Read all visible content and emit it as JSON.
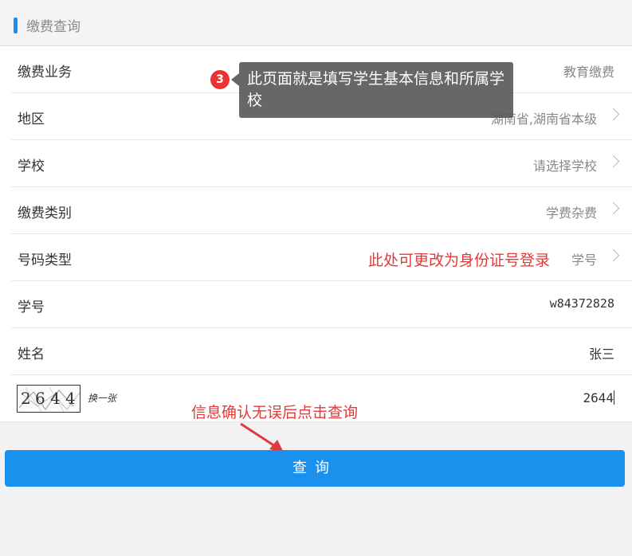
{
  "section": {
    "title": "缴费查询"
  },
  "rows": {
    "business": {
      "label": "缴费业务",
      "value": "教育缴费"
    },
    "region": {
      "label": "地区",
      "value": "湖南省,湖南省本级"
    },
    "school": {
      "label": "学校",
      "value": "请选择学校"
    },
    "fee_type": {
      "label": "缴费类别",
      "value": "学费杂费"
    },
    "id_type": {
      "label": "号码类型",
      "value": "学号"
    },
    "student_no": {
      "label": "学号",
      "value": "w84372828"
    },
    "name": {
      "label": "姓名",
      "value": "张三"
    },
    "captcha": {
      "digits": [
        "2",
        "6",
        "4",
        "4"
      ],
      "refresh_label": "换一张",
      "value": "2644"
    }
  },
  "tooltip": {
    "step": "3",
    "text": "此页面就是填写学生基本信息和所属学校"
  },
  "annotations": {
    "id_type_hint": "此处可更改为身份证号登录",
    "confirm_hint": "信息确认无误后点击查询"
  },
  "query_button": {
    "label": "查询"
  },
  "colors": {
    "accent": "#1a91ec",
    "annotation": "#e03a3a",
    "badge": "#ea3333"
  }
}
